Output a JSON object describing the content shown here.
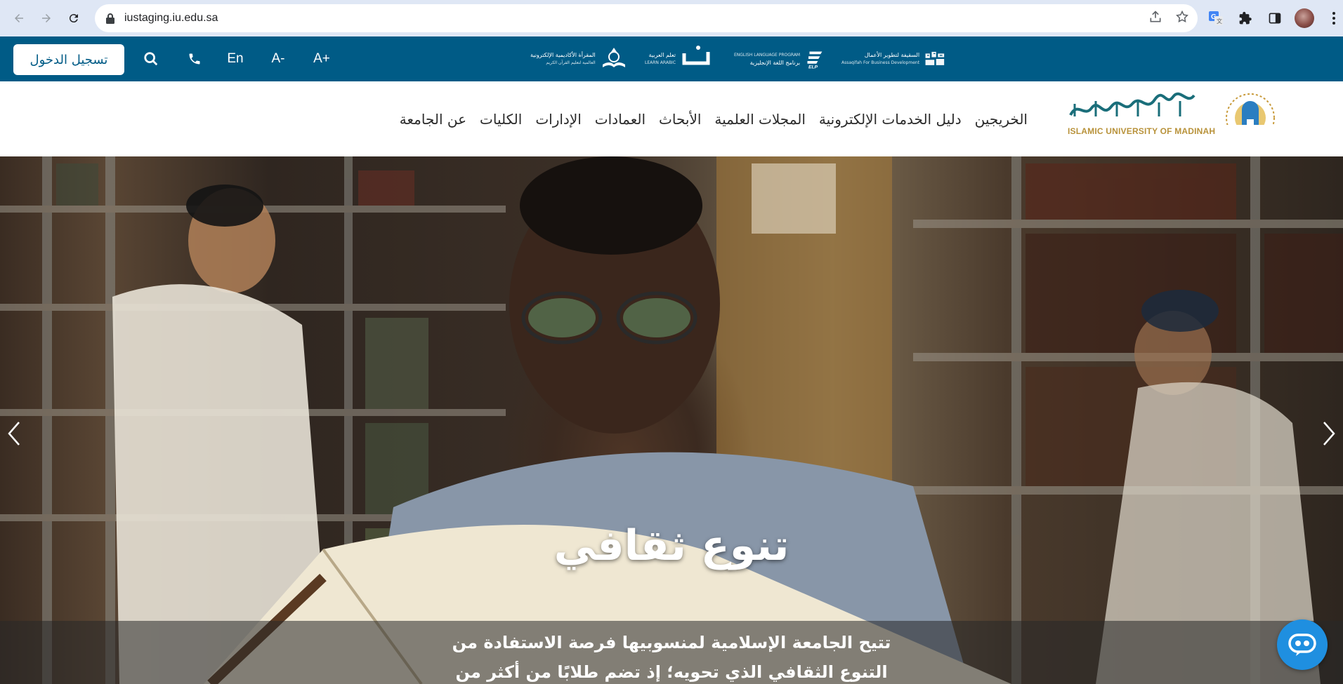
{
  "browser": {
    "url": "iustaging.iu.edu.sa"
  },
  "topbar": {
    "login_label": "تسجيل الدخول",
    "lang_label": "En",
    "font_decrease_label": "A-",
    "font_increase_label": "A+",
    "partners": [
      {
        "name": "السقيفة لتطوير الأعمال",
        "sub": "Assaqifah For Business Development"
      },
      {
        "name": "برنامج اللغة الإنجليزية",
        "sub": "ENGLISH LANGUAGE PROGRAM",
        "mark": "ELP"
      },
      {
        "name": "تعلم العربية",
        "sub": "LEARN ARABIC",
        "mark": "ض"
      },
      {
        "name": "المقرأة الأكاديمية الإلكترونية",
        "sub": "العالمية لتعليم القرآن الكريم"
      }
    ]
  },
  "header": {
    "logo_en": "ISLAMIC UNIVERSITY OF MADINAH",
    "nav": [
      "عن الجامعة",
      "الكليات",
      "الإدارات",
      "العمادات",
      "الأبحاث",
      "المجلات العلمية",
      "دليل الخدمات الإلكترونية",
      "الخريجين"
    ]
  },
  "hero": {
    "title": "تنوع ثقافي",
    "caption": "تتيح الجامعة الإسلامية لمنسوبيها فرصة الاستفادة من",
    "caption_line2": "التنوع الثقافي الذي تحويه؛ إذ تضم طلابًا من أكثر من"
  },
  "colors": {
    "brand_blue": "#005b86",
    "chrome_bg": "#dfe7f5",
    "gold": "#b8923a",
    "chatbot_blue": "#1f8fe0"
  }
}
